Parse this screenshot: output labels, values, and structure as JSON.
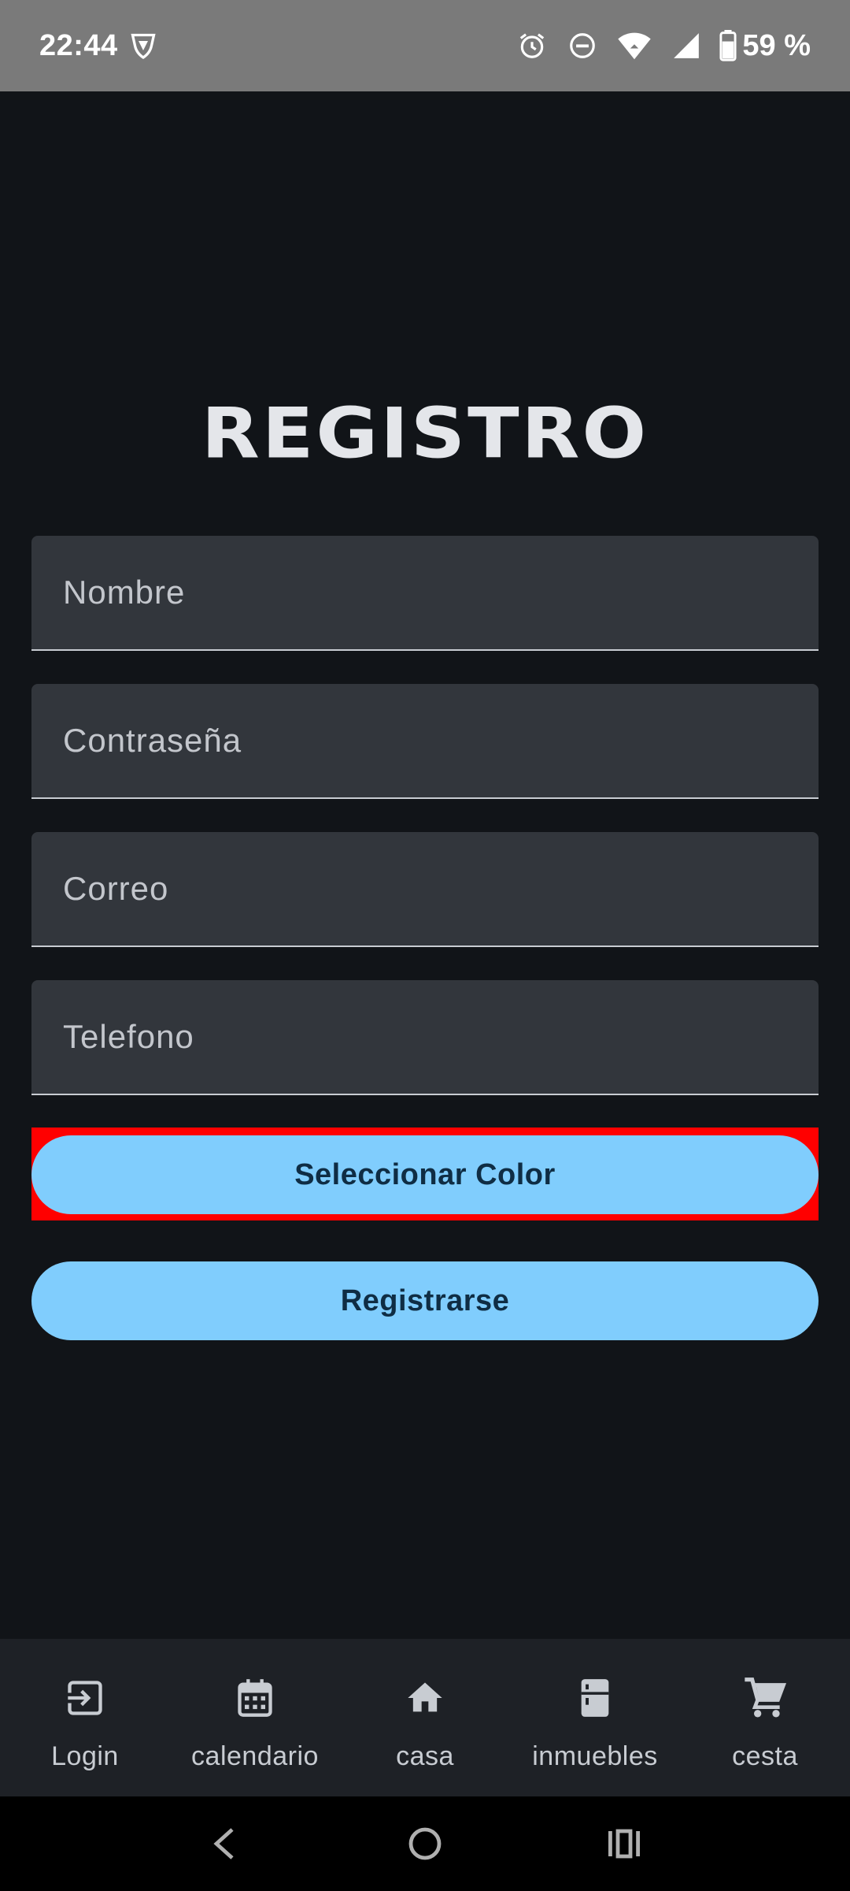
{
  "status_bar": {
    "time": "22:44",
    "battery": "59 %",
    "icons": [
      "vpn-shield-icon",
      "alarm-icon",
      "do-not-disturb-icon",
      "wifi-icon",
      "signal-icon",
      "battery-icon"
    ]
  },
  "page": {
    "title": "REGISTRO"
  },
  "form": {
    "name_placeholder": "Nombre",
    "password_placeholder": "Contraseña",
    "email_placeholder": "Correo",
    "phone_placeholder": "Telefono",
    "select_color_label": "Seleccionar Color",
    "register_label": "Registrarse"
  },
  "bottom_nav": {
    "items": [
      {
        "label": "Login",
        "icon": "login-icon"
      },
      {
        "label": "calendario",
        "icon": "calendar-icon"
      },
      {
        "label": "casa",
        "icon": "home-icon"
      },
      {
        "label": "inmuebles",
        "icon": "fridge-icon"
      },
      {
        "label": "cesta",
        "icon": "cart-icon"
      }
    ]
  },
  "system_nav": {
    "icons": [
      "back-icon",
      "home-circle-icon",
      "recents-icon"
    ]
  },
  "colors": {
    "background": "#111418",
    "field_background": "#32363c",
    "button_accent": "#80cdfd",
    "highlight": "#ff0000",
    "status_bar": "#7a7a7a"
  }
}
